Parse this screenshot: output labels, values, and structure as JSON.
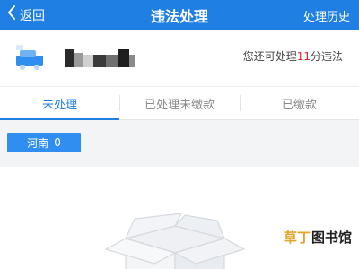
{
  "header": {
    "back_label": "返回",
    "title": "违法处理",
    "history_label": "处理历史",
    "bg_color": "#1f7fe2"
  },
  "vehicle": {
    "remaining_prefix": "您还可处理",
    "remaining_points": "11",
    "remaining_suffix": "分违法"
  },
  "tabs": [
    {
      "label": "未处理",
      "active": true
    },
    {
      "label": "已处理未缴款",
      "active": false
    },
    {
      "label": "已缴款",
      "active": false
    }
  ],
  "region_filter": {
    "name": "河南",
    "count": "0"
  },
  "watermark": {
    "part1": "草丁",
    "part2": "图书馆"
  },
  "icons": {
    "back": "chevron-left-icon",
    "car": "car-icon",
    "empty": "empty-box-icon"
  }
}
